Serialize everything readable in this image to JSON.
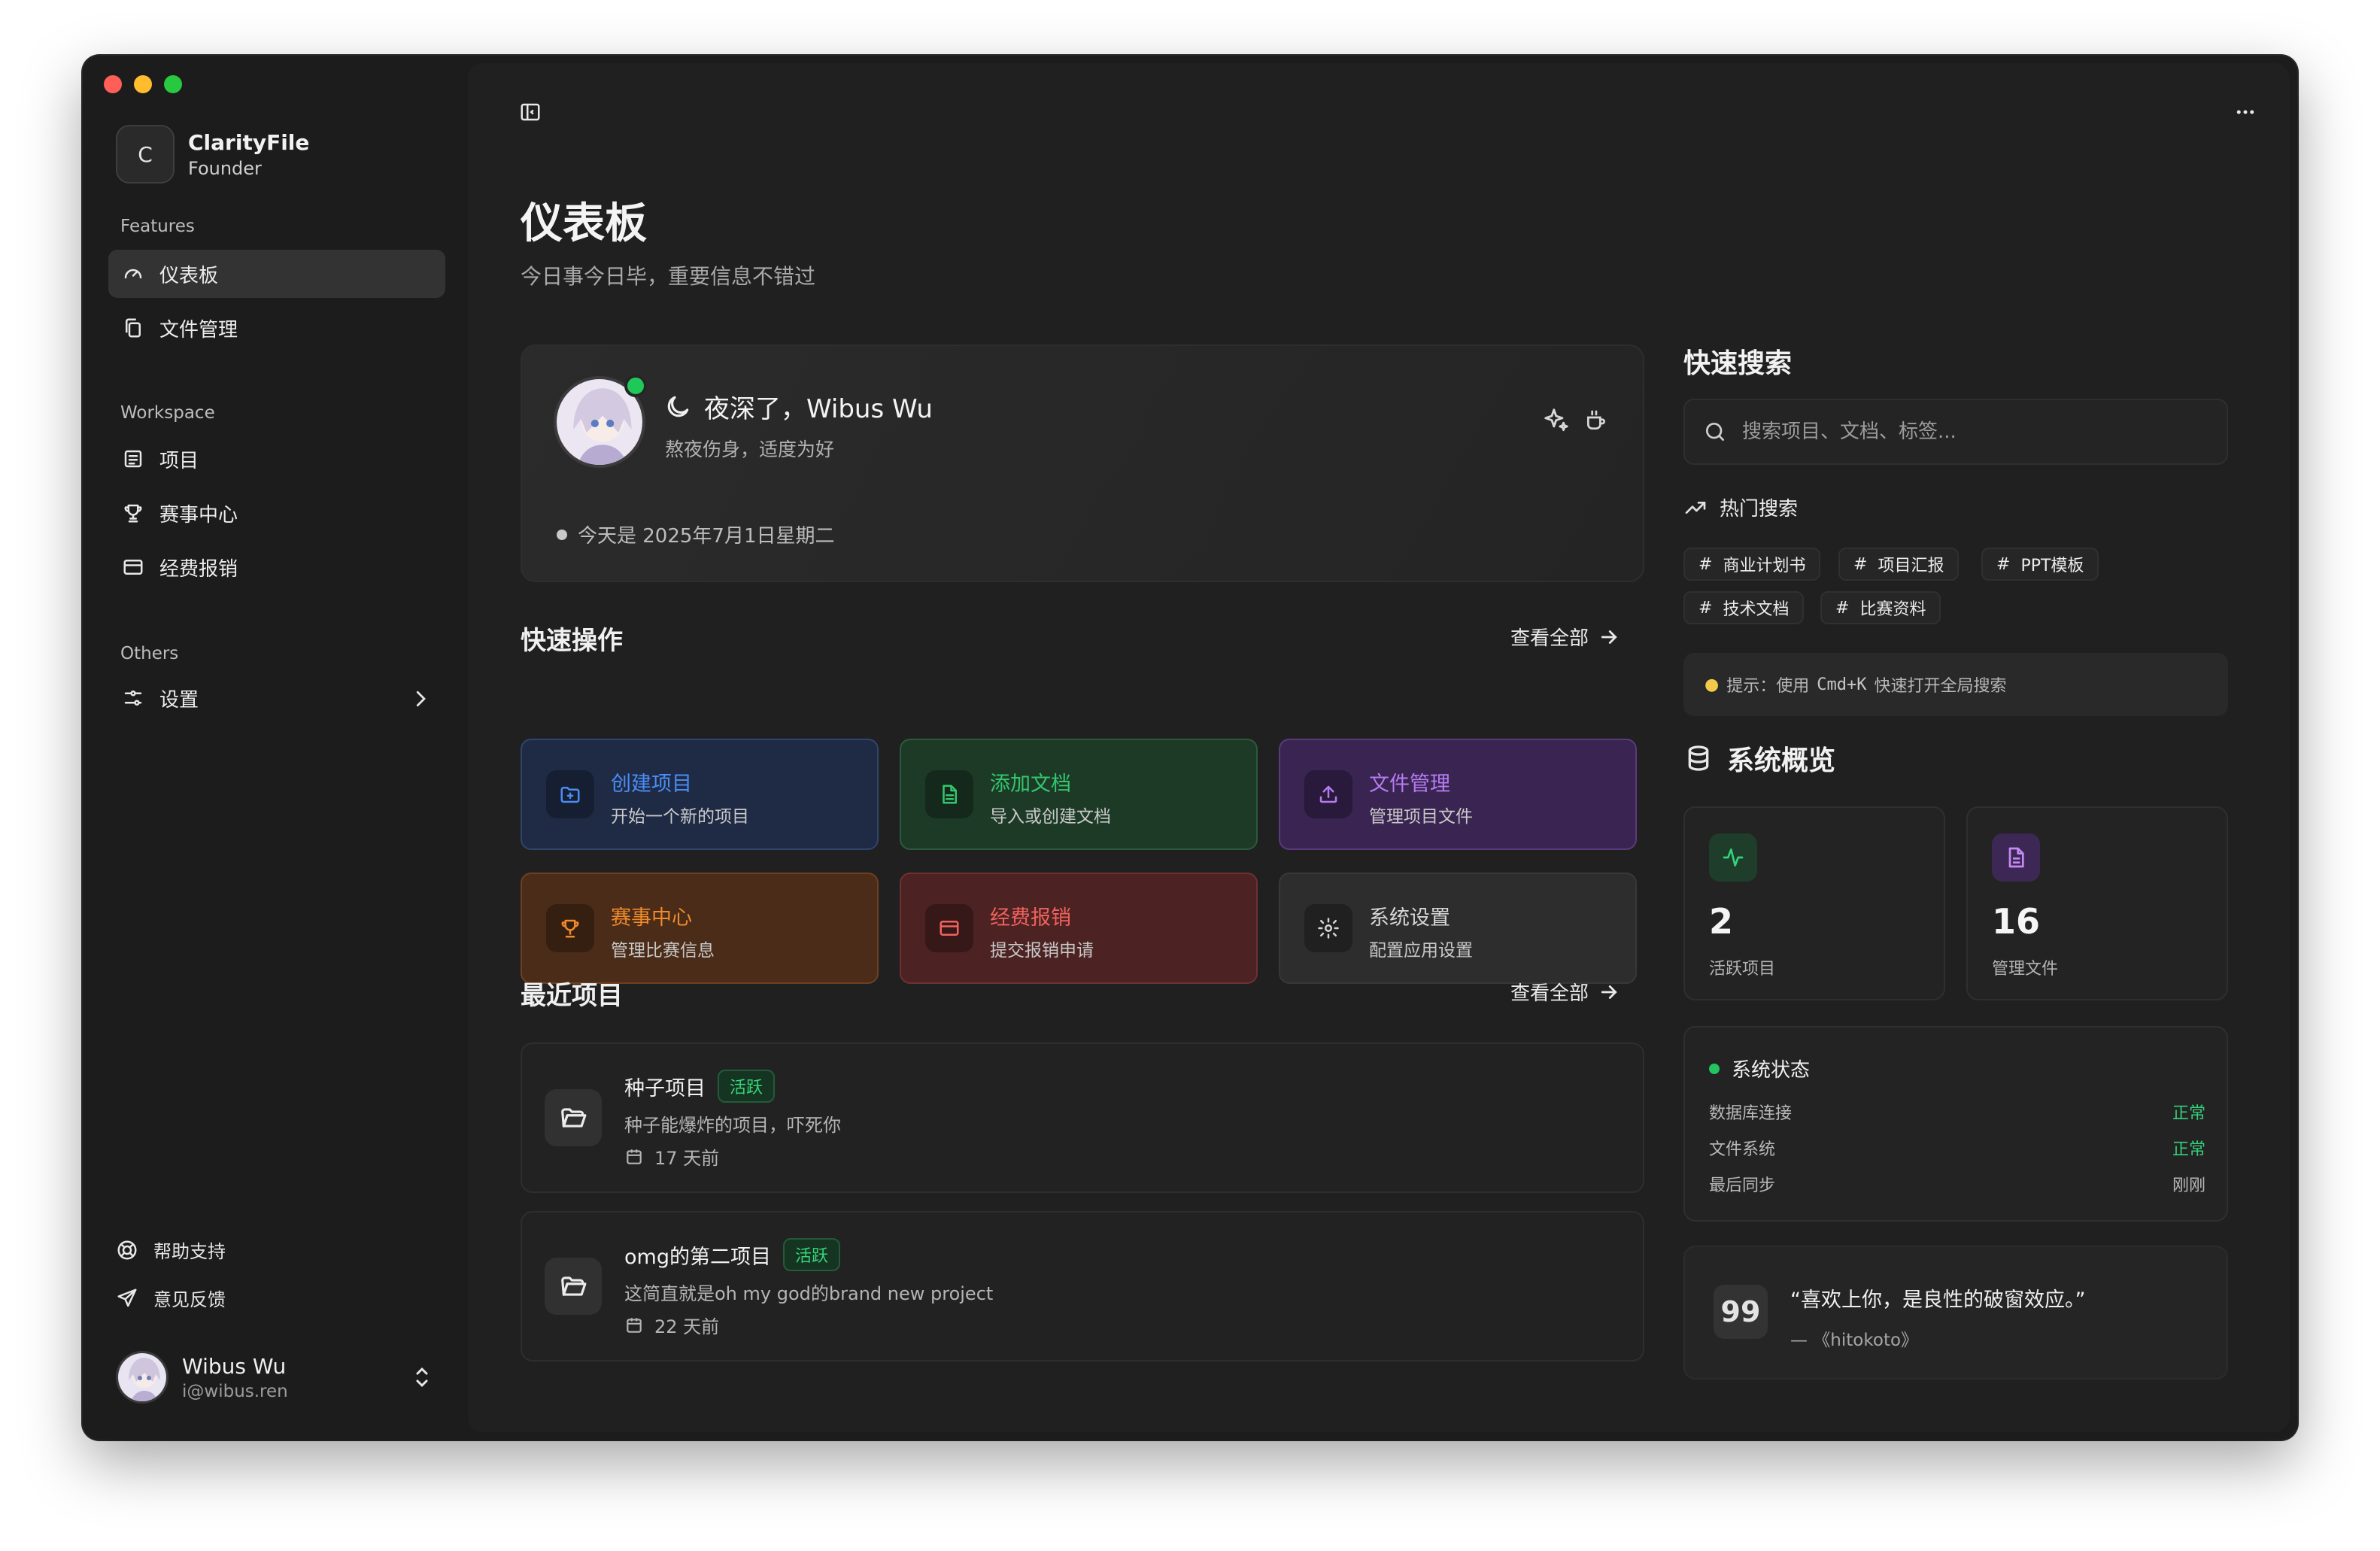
{
  "app": {
    "name": "ClarityFile",
    "role": "Founder",
    "logo_letter": "C"
  },
  "sidebar": {
    "sections": {
      "features": "Features",
      "workspace": "Workspace",
      "others": "Others"
    },
    "features": [
      {
        "label": "仪表板",
        "icon": "gauge-icon",
        "active": true
      },
      {
        "label": "文件管理",
        "icon": "copy-icon"
      }
    ],
    "workspace": [
      {
        "label": "项目",
        "icon": "list-icon"
      },
      {
        "label": "赛事中心",
        "icon": "trophy-icon"
      },
      {
        "label": "经费报销",
        "icon": "credit-card-icon"
      }
    ],
    "others": [
      {
        "label": "设置",
        "icon": "sliders-icon"
      }
    ],
    "footer": [
      {
        "label": "帮助支持",
        "icon": "lifebuoy-icon"
      },
      {
        "label": "意见反馈",
        "icon": "send-icon"
      }
    ],
    "user": {
      "name": "Wibus Wu",
      "email": "i@wibus.ren"
    }
  },
  "page": {
    "title": "仪表板",
    "subtitle": "今日事今日毕，重要信息不错过"
  },
  "greeting": {
    "title": "夜深了，Wibus Wu",
    "subtitle": "熬夜伤身，适度为好",
    "date": "今天是 2025年7月1日星期二"
  },
  "quick_actions": {
    "title": "快速操作",
    "view_all": "查看全部",
    "items": [
      {
        "title": "创建项目",
        "desc": "开始一个新的项目",
        "color": "#4a8df6",
        "bg": "#1f2b45",
        "border": "#30456c",
        "icon": "folder-plus-icon"
      },
      {
        "title": "添加文档",
        "desc": "导入或创建文档",
        "color": "#34c76e",
        "bg": "#1d3a27",
        "border": "#2b5a3b",
        "icon": "file-text-icon"
      },
      {
        "title": "文件管理",
        "desc": "管理项目文件",
        "color": "#b57cf0",
        "bg": "#3a2452",
        "border": "#5a3a7d",
        "icon": "upload-icon"
      },
      {
        "title": "赛事中心",
        "desc": "管理比赛信息",
        "color": "#f08a2c",
        "bg": "#4a2c18",
        "border": "#6e4021",
        "icon": "trophy-icon"
      },
      {
        "title": "经费报销",
        "desc": "提交报销申请",
        "color": "#f0625c",
        "bg": "#4d2223",
        "border": "#6e3132",
        "icon": "credit-card-icon"
      },
      {
        "title": "系统设置",
        "desc": "配置应用设置",
        "color": "#d6d6d6",
        "bg": "#2d2d2d",
        "border": "#383838",
        "icon": "gear-icon"
      }
    ]
  },
  "recent": {
    "title": "最近项目",
    "view_all": "查看全部",
    "items": [
      {
        "name": "种子项目",
        "status": "活跃",
        "desc": "种子能爆炸的项目，吓死你",
        "time": "17 天前"
      },
      {
        "name": "omg的第二项目",
        "status": "活跃",
        "desc": "这简直就是oh my god的brand new project",
        "time": "22 天前"
      }
    ]
  },
  "search": {
    "title": "快速搜索",
    "placeholder": "搜索项目、文档、标签...",
    "hot_label": "热门搜索",
    "tags": [
      "商业计划书",
      "项目汇报",
      "PPT模板",
      "技术文档",
      "比赛资料"
    ],
    "tip_prefix": "提示：使用",
    "tip_key": "Cmd+K",
    "tip_suffix": "快速打开全局搜索"
  },
  "overview": {
    "title": "系统概览",
    "stats": [
      {
        "value": "2",
        "label": "活跃项目",
        "color": "#35d07a",
        "bg": "#1e3d2a",
        "icon": "activity-icon"
      },
      {
        "value": "16",
        "label": "管理文件",
        "color": "#c48af5",
        "bg": "#3d2755",
        "icon": "file-text-icon"
      }
    ],
    "status": {
      "title": "系统状态",
      "rows": [
        {
          "label": "数据库连接",
          "value": "正常",
          "ok": true
        },
        {
          "label": "文件系统",
          "value": "正常",
          "ok": true
        },
        {
          "label": "最后同步",
          "value": "刚刚",
          "ok": false
        }
      ]
    }
  },
  "quote": {
    "text": "“喜欢上你，是良性的破窗效应。”",
    "source": "— 《hitokoto》"
  }
}
